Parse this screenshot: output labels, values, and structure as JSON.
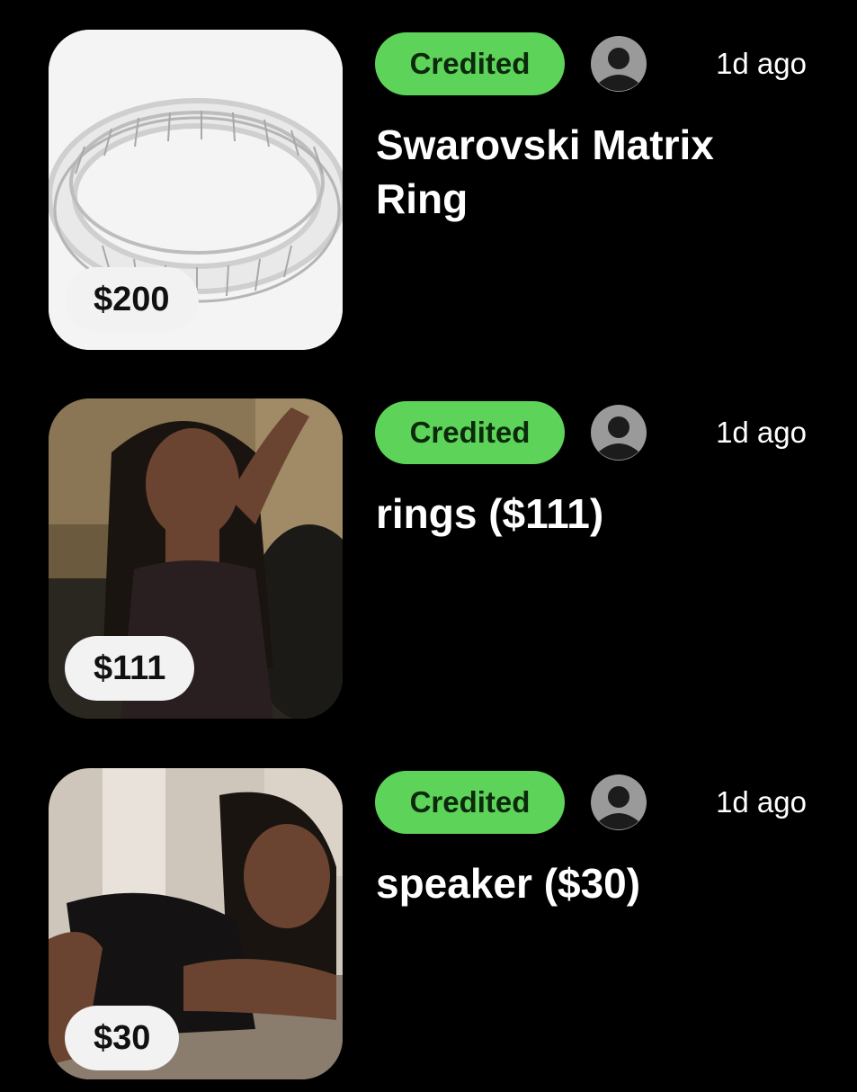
{
  "items": [
    {
      "price": "$200",
      "status": "Credited",
      "time": "1d ago",
      "title": "Swarovski Matrix Ring",
      "image_icon": "ring-photo"
    },
    {
      "price": "$111",
      "status": "Credited",
      "time": "1d ago",
      "title": "rings ($111)",
      "image_icon": "portrait-photo"
    },
    {
      "price": "$30",
      "status": "Credited",
      "time": "1d ago",
      "title": "speaker ($30)",
      "image_icon": "portrait-photo"
    }
  ],
  "colors": {
    "background": "#000000",
    "badge": "#5ed35a",
    "pill": "#f2f2f2"
  }
}
